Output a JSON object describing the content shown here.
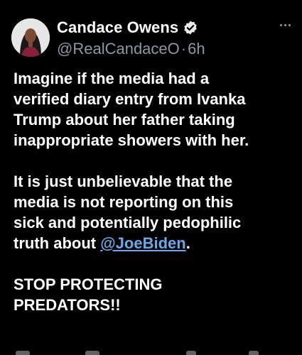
{
  "tweet": {
    "author": {
      "display_name": "Candace Owens",
      "handle": "@RealCandaceO",
      "separator": "·",
      "time": "6h",
      "verified_icon": "verified-badge-icon",
      "avatar_icon": "avatar"
    },
    "more_icon": "more-options-icon",
    "paragraph1": "Imagine if the media had a\nverified diary entry from Ivanka\nTrump about her father taking\ninappropriate showers with her.",
    "paragraph2_before": "It is just unbelievable that the\nmedia is not reporting on this\nsick and potentially pedophilic\ntruth about ",
    "mention": "@JoeBiden",
    "paragraph2_after": ".",
    "paragraph3": "STOP PROTECTING\nPREDATORS!!"
  },
  "colors": {
    "background": "#000000",
    "text": "#ffffff",
    "secondary": "#8b98a5",
    "link": "#6aa9e9",
    "verified": "#e7e9ea"
  }
}
